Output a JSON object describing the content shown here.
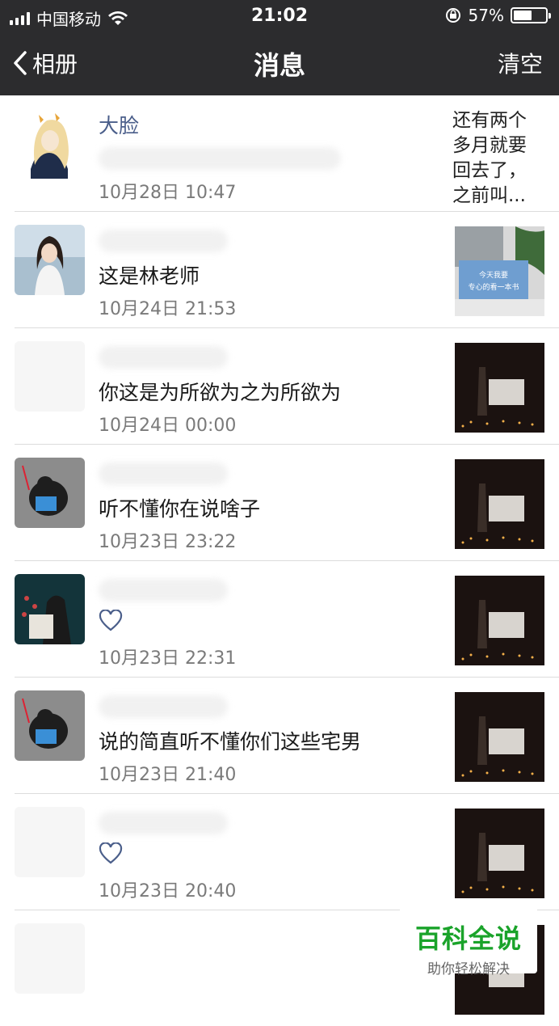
{
  "status_bar": {
    "carrier": "中国移动",
    "time": "21:02",
    "battery": "57%",
    "battery_level": 0.57
  },
  "nav": {
    "back_label": "相册",
    "title": "消息",
    "clear_label": "清空"
  },
  "messages": [
    {
      "name": "大脸",
      "content": "",
      "time": "10月28日 10:47",
      "side_text": "还有两个多月就要回去了，之前叫..."
    },
    {
      "name": "",
      "content": "这是林老师",
      "time": "10月24日 21:53"
    },
    {
      "name": "",
      "content": "你这是为所欲为之为所欲为",
      "time": "10月24日 00:00"
    },
    {
      "name": "",
      "content": "听不懂你在说啥子",
      "time": "10月23日 23:22"
    },
    {
      "name": "",
      "content": "",
      "time": "10月23日 22:31",
      "like": true
    },
    {
      "name": "",
      "content": "说的简直听不懂你们这些宅男",
      "time": "10月23日 21:40"
    },
    {
      "name": "",
      "content": "",
      "time": "10月23日 20:40",
      "like": true
    }
  ],
  "thumb_text": "今天我要专心的看一本书",
  "watermark": {
    "main": "百科全说",
    "sub": "助你轻松解决"
  },
  "colors": {
    "bar_bg": "#2c2c2e",
    "name_blue": "#4a5e8a",
    "watermark_green": "#1aa32a"
  }
}
